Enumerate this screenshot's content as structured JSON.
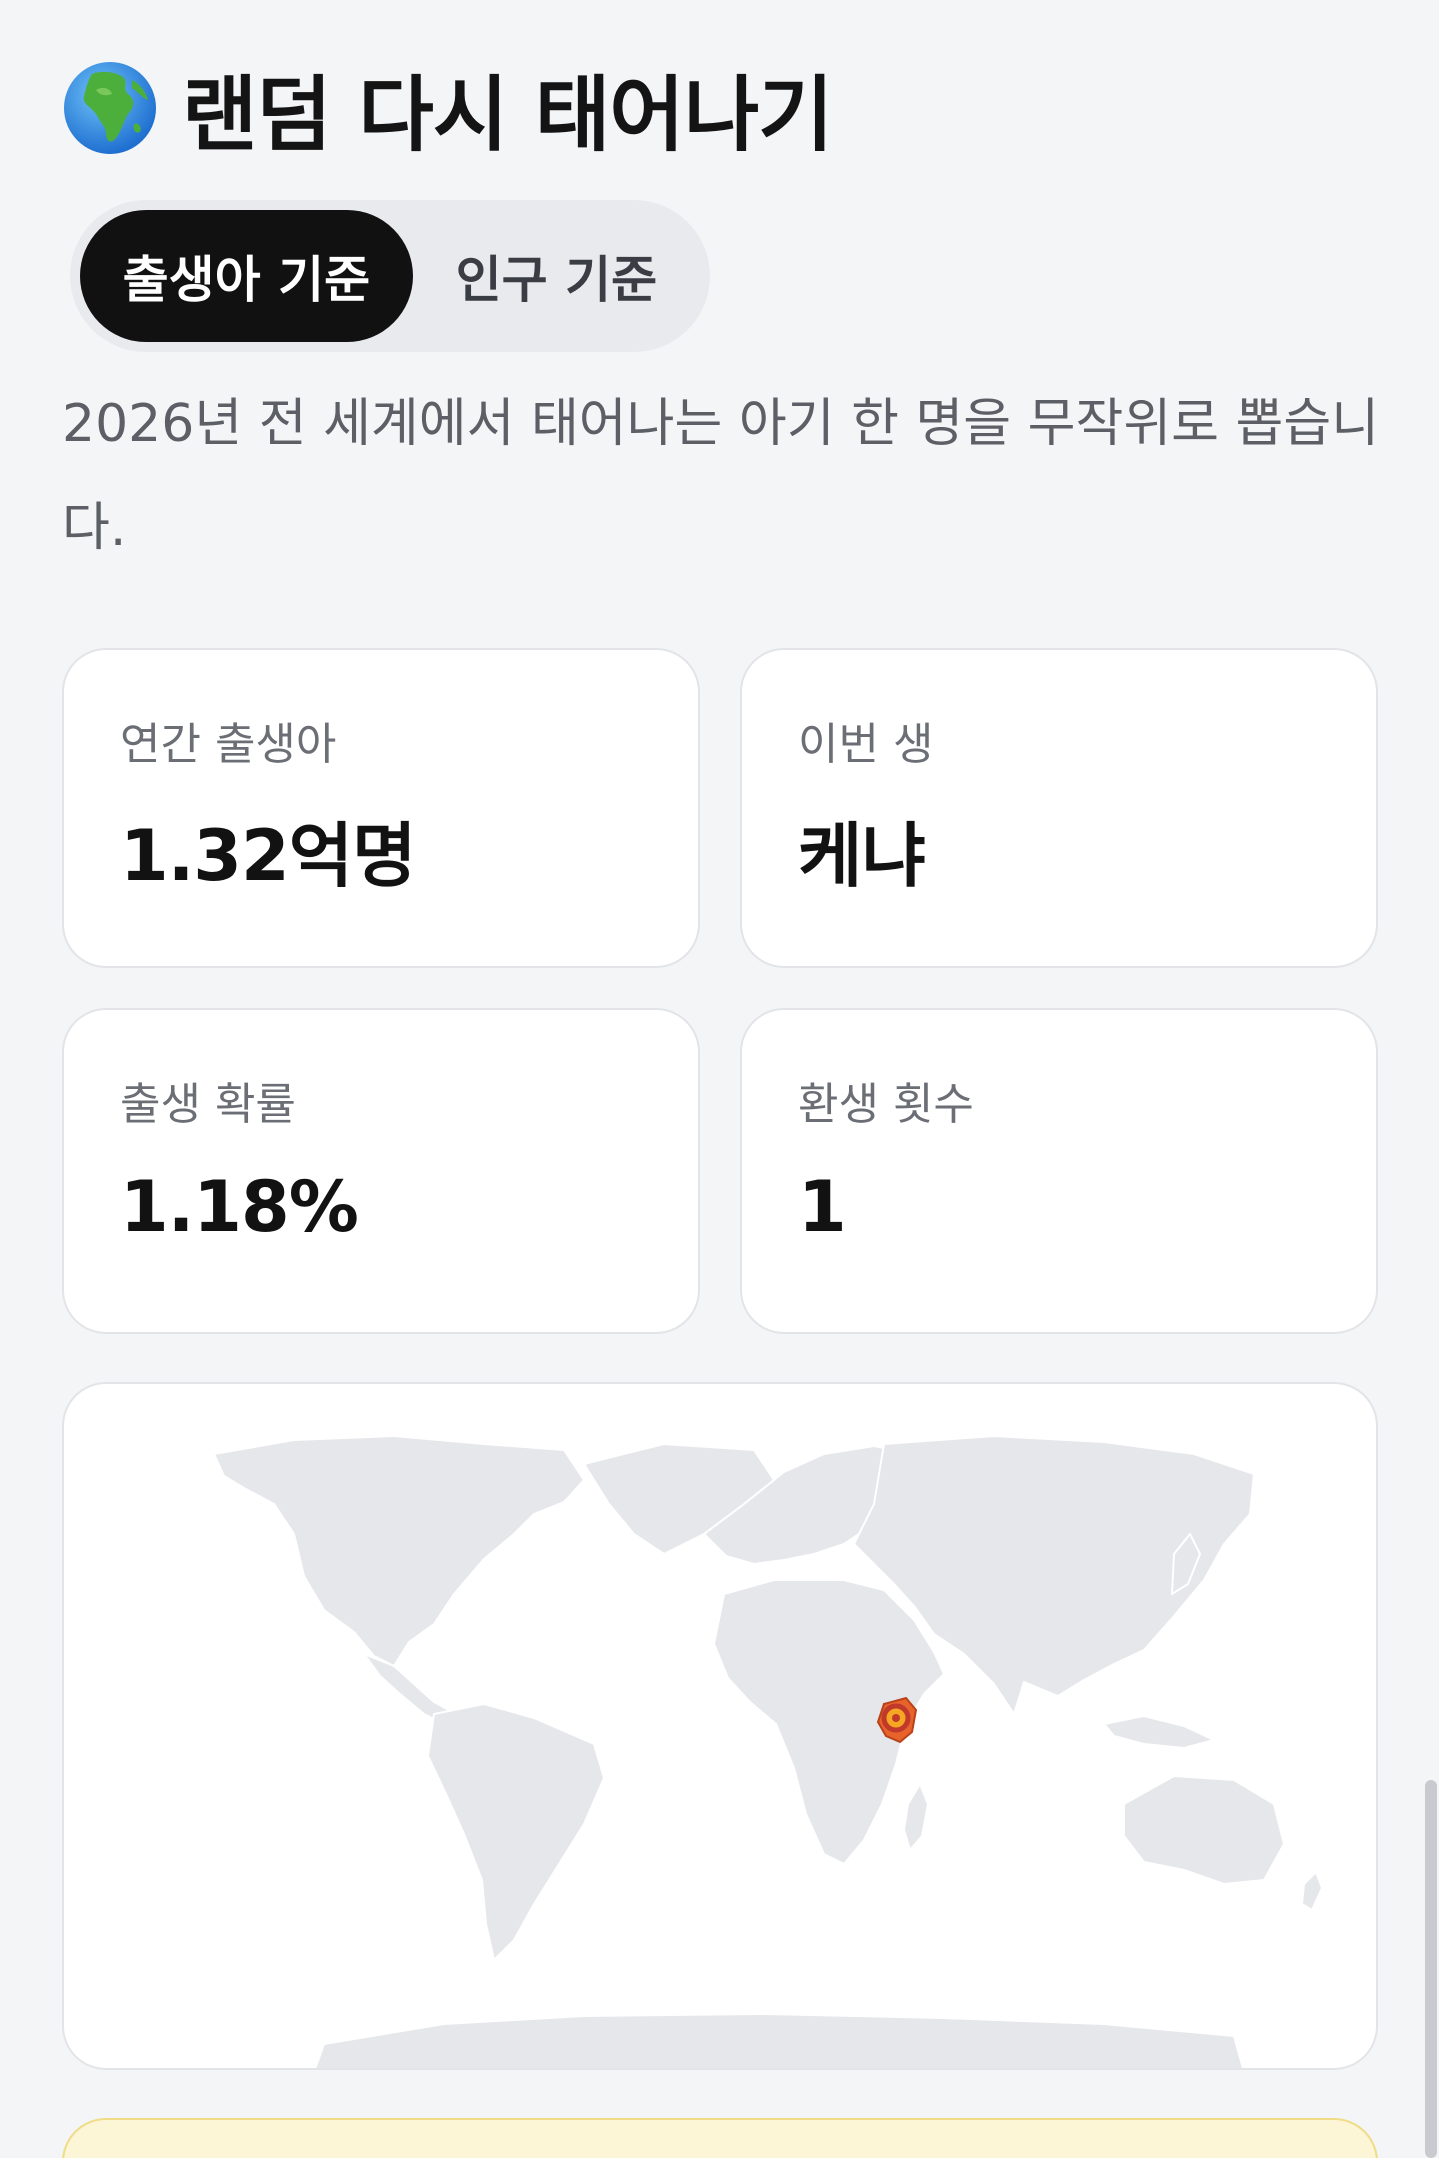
{
  "header": {
    "title": "랜덤 다시 태어나기",
    "icon": "globe-africa-icon"
  },
  "mode_toggle": {
    "options": [
      {
        "label": "출생아 기준",
        "selected": true
      },
      {
        "label": "인구 기준",
        "selected": false
      }
    ]
  },
  "description": "2026년 전 세계에서 태어나는 아기 한 명을 무작위로 뽑습니다.",
  "stats": {
    "annual_births": {
      "label": "연간 출생아",
      "value": "1.32억명"
    },
    "this_life": {
      "label": "이번 생",
      "value": "케냐"
    },
    "birth_probability": {
      "label": "출생 확률",
      "value": "1.18%"
    },
    "rebirth_count": {
      "label": "환생 횟수",
      "value": "1"
    }
  },
  "map": {
    "highlighted_country": "Kenya",
    "land_color": "#e6e7ea",
    "highlight_color": "#e8632b",
    "marker_color": "#f5a623"
  }
}
